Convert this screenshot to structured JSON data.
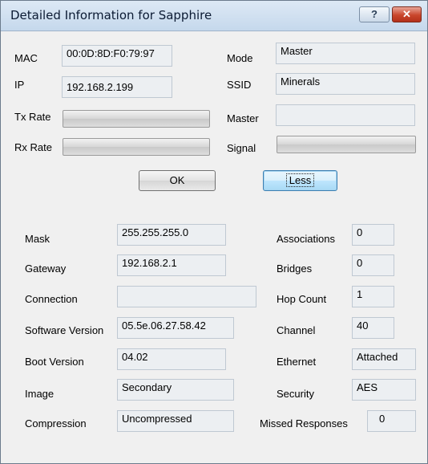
{
  "window": {
    "title": "Detailed Information for Sapphire",
    "help_glyph": "?",
    "close_glyph": "✕"
  },
  "top": {
    "mac_label": "MAC",
    "mac_value": "00:0D:8D:F0:79:97",
    "ip_label": "IP",
    "ip_value": "192.168.2.199",
    "txrate_label": "Tx Rate",
    "rxrate_label": "Rx Rate",
    "mode_label": "Mode",
    "mode_value": "Master",
    "ssid_label": "SSID",
    "ssid_value": "Minerals",
    "master_label": "Master",
    "master_value": "",
    "signal_label": "Signal"
  },
  "buttons": {
    "ok": "OK",
    "less": "Less"
  },
  "details": {
    "mask_label": "Mask",
    "mask_value": "255.255.255.0",
    "gateway_label": "Gateway",
    "gateway_value": "192.168.2.1",
    "connection_label": "Connection",
    "connection_value": "",
    "swver_label": "Software Version",
    "swver_value": "05.5e.06.27.58.42",
    "bootver_label": "Boot Version",
    "bootver_value": "04.02",
    "image_label": "Image",
    "image_value": "Secondary",
    "compression_label": "Compression",
    "compression_value": "Uncompressed",
    "associations_label": "Associations",
    "associations_value": "0",
    "bridges_label": "Bridges",
    "bridges_value": "0",
    "hopcount_label": "Hop Count",
    "hopcount_value": "1",
    "channel_label": "Channel",
    "channel_value": "40",
    "ethernet_label": "Ethernet",
    "ethernet_value": "Attached",
    "security_label": "Security",
    "security_value": "AES",
    "missed_label": "Missed Responses",
    "missed_value": "0"
  }
}
